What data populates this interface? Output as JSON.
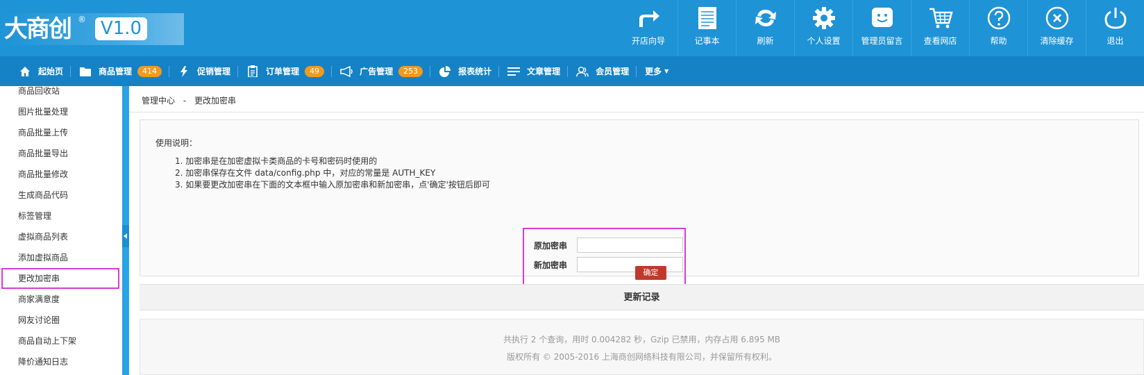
{
  "logo": {
    "brand": "大商创",
    "registered": "®",
    "version": "V1.0"
  },
  "topnav": [
    {
      "label": "开店向导",
      "icon": "share-arrow-icon"
    },
    {
      "label": "记事本",
      "icon": "notepad-icon"
    },
    {
      "label": "刷新",
      "icon": "refresh-icon"
    },
    {
      "label": "个人设置",
      "icon": "gear-icon"
    },
    {
      "label": "管理员留言",
      "icon": "message-icon"
    },
    {
      "label": "查看网店",
      "icon": "cart-icon"
    },
    {
      "label": "帮助",
      "icon": "help-icon"
    },
    {
      "label": "清除缓存",
      "icon": "clear-icon"
    },
    {
      "label": "退出",
      "icon": "power-icon"
    }
  ],
  "mainnav": [
    {
      "label": "起始页",
      "icon": "home-icon",
      "badge": ""
    },
    {
      "label": "商品管理",
      "icon": "folder-icon",
      "badge": "414"
    },
    {
      "label": "促销管理",
      "icon": "bolt-icon",
      "badge": ""
    },
    {
      "label": "订单管理",
      "icon": "clipboard-icon",
      "badge": "49"
    },
    {
      "label": "广告管理",
      "icon": "megaphone-icon",
      "badge": "253"
    },
    {
      "label": "报表统计",
      "icon": "pie-chart-icon",
      "badge": ""
    },
    {
      "label": "文章管理",
      "icon": "list-icon",
      "badge": ""
    },
    {
      "label": "会员管理",
      "icon": "users-icon",
      "badge": ""
    },
    {
      "label": "更多",
      "icon": "caret-down-icon",
      "badge": ""
    }
  ],
  "sidebar": {
    "items": [
      "商品回收站",
      "图片批量处理",
      "商品批量上传",
      "商品批量导出",
      "商品批量修改",
      "生成商品代码",
      "标签管理",
      "虚拟商品列表",
      "添加虚拟商品",
      "更改加密串",
      "商家满意度",
      "网友讨论圈",
      "商品自动上下架",
      "降价通知日志"
    ],
    "active": "更改加密串"
  },
  "breadcrumb": {
    "root": "管理中心",
    "sep": "-",
    "current": "更改加密串"
  },
  "usage": {
    "title": "使用说明：",
    "items": [
      "1. 加密串是在加密虚拟卡类商品的卡号和密码时使用的",
      "2. 加密串保存在文件 data/config.php 中，对应的常量是 AUTH_KEY",
      "3. 如果要更改加密串在下面的文本框中输入原加密串和新加密串，点'确定'按钮后即可"
    ]
  },
  "form": {
    "old_label": "原加密串",
    "old_value": "",
    "new_label": "新加密串",
    "new_value": "",
    "confirm": "确定"
  },
  "changelog": "更新记录",
  "footer": {
    "line1": "共执行 2 个查询，用时 0.004282 秒，Gzip 已禁用，内存占用 6.895 MB",
    "line2": "版权所有 © 2005-2016 上海商创网络科技有限公司，并保留所有权利。"
  },
  "colors": {
    "header": "#1e93d6",
    "nav": "#1682c6",
    "badge": "#f39a1d",
    "highlight": "#d63ad9",
    "confirm": "#c0392b"
  }
}
